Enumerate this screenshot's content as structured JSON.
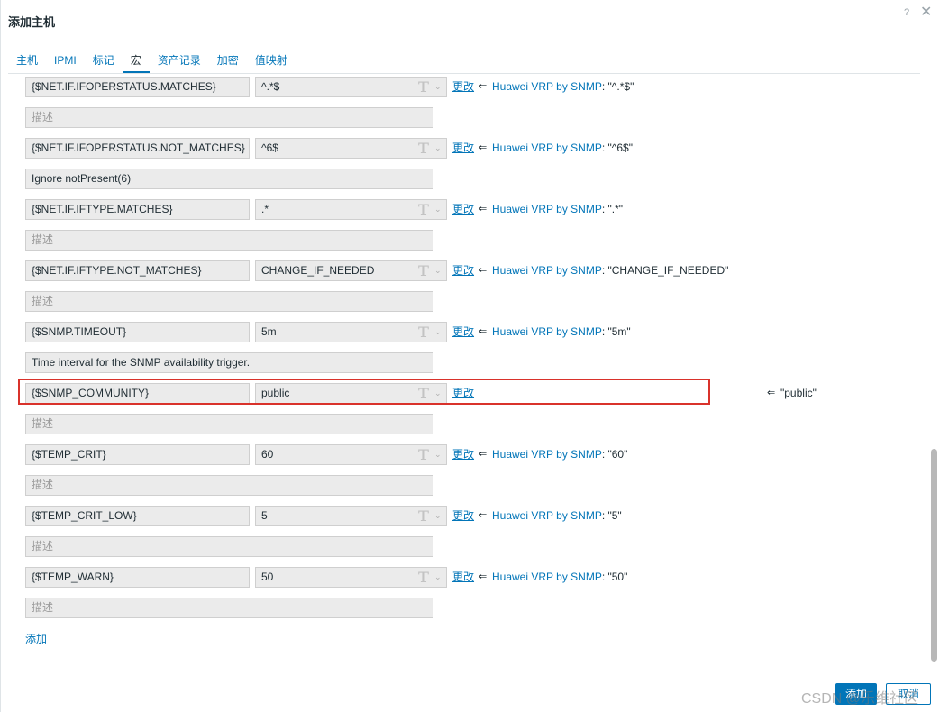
{
  "dialog": {
    "title": "添加主机",
    "help_glyph": "?",
    "close_glyph": "✕"
  },
  "tabs": [
    "主机",
    "IPMI",
    "标记",
    "宏",
    "资产记录",
    "加密",
    "值映射"
  ],
  "active_tab": "宏",
  "macros": [
    {
      "name": "{$NET.IF.IFOPERSTATUS.MATCHES}",
      "value": "^.*$",
      "description": "",
      "change": "更改",
      "arrow": "⇐",
      "template": "Huawei VRP by SNMP",
      "inherited": ": \"^.*$\""
    },
    {
      "name": "{$NET.IF.IFOPERSTATUS.NOT_MATCHES}",
      "value": "^6$",
      "description": "Ignore notPresent(6)",
      "change": "更改",
      "arrow": "⇐",
      "template": "Huawei VRP by SNMP",
      "inherited": ": \"^6$\""
    },
    {
      "name": "{$NET.IF.IFTYPE.MATCHES}",
      "value": ".*",
      "description": "",
      "change": "更改",
      "arrow": "⇐",
      "template": "Huawei VRP by SNMP",
      "inherited": ": \".*\""
    },
    {
      "name": "{$NET.IF.IFTYPE.NOT_MATCHES}",
      "value": "CHANGE_IF_NEEDED",
      "description": "",
      "change": "更改",
      "arrow": "⇐",
      "template": "Huawei VRP by SNMP",
      "inherited": ": \"CHANGE_IF_NEEDED\""
    },
    {
      "name": "{$SNMP.TIMEOUT}",
      "value": "5m",
      "description": "Time interval for the SNMP availability trigger.",
      "change": "更改",
      "arrow": "⇐",
      "template": "Huawei VRP by SNMP",
      "inherited": ": \"5m\""
    },
    {
      "name": "{$SNMP_COMMUNITY}",
      "value": "public",
      "description": "",
      "change": "更改",
      "arrow": "⇐",
      "template": "",
      "inherited": "\"public\""
    },
    {
      "name": "{$TEMP_CRIT}",
      "value": "60",
      "description": "",
      "change": "更改",
      "arrow": "⇐",
      "template": "Huawei VRP by SNMP",
      "inherited": ": \"60\""
    },
    {
      "name": "{$TEMP_CRIT_LOW}",
      "value": "5",
      "description": "",
      "change": "更改",
      "arrow": "⇐",
      "template": "Huawei VRP by SNMP",
      "inherited": ": \"5\""
    },
    {
      "name": "{$TEMP_WARN}",
      "value": "50",
      "description": "",
      "change": "更改",
      "arrow": "⇐",
      "template": "Huawei VRP by SNMP",
      "inherited": ": \"50\""
    }
  ],
  "description_placeholder": "描述",
  "type_glyph": "T",
  "chevron_glyph": "⌄",
  "add_link": "添加",
  "footer": {
    "add_button": "添加",
    "cancel_button": "取消"
  },
  "watermark": "CSDN @乐维社区",
  "colors": {
    "link": "#0275b8",
    "highlight": "#d9322b",
    "field_bg": "#ebebeb"
  }
}
